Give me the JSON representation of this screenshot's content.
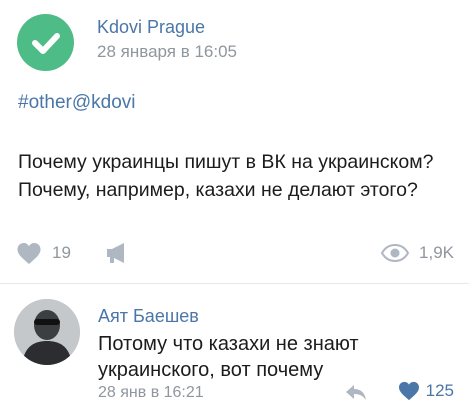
{
  "post": {
    "author": "Kdovi Prague",
    "time": "28 января в 16:05",
    "hashtag": "#other@kdovi",
    "text_lines": [
      "Почему украинцы пишут в ВК на украинском?",
      "Почему, например, казахи не делают этого?"
    ],
    "likes": "19",
    "views": "1,9K"
  },
  "comment": {
    "author": "Аят Баешев",
    "text_lines": [
      "Потому что казахи не знают",
      "украинского, вот почему"
    ],
    "time": "28 янв в 16:21",
    "likes": "125"
  },
  "icons": {
    "badge": "checkmark-icon",
    "like": "heart-icon",
    "share": "megaphone-icon",
    "views": "eye-icon",
    "reply": "reply-arrow-icon"
  },
  "colors": {
    "badge": "#4dbc86",
    "link": "#4a76a8",
    "muted": "#8f969e"
  }
}
